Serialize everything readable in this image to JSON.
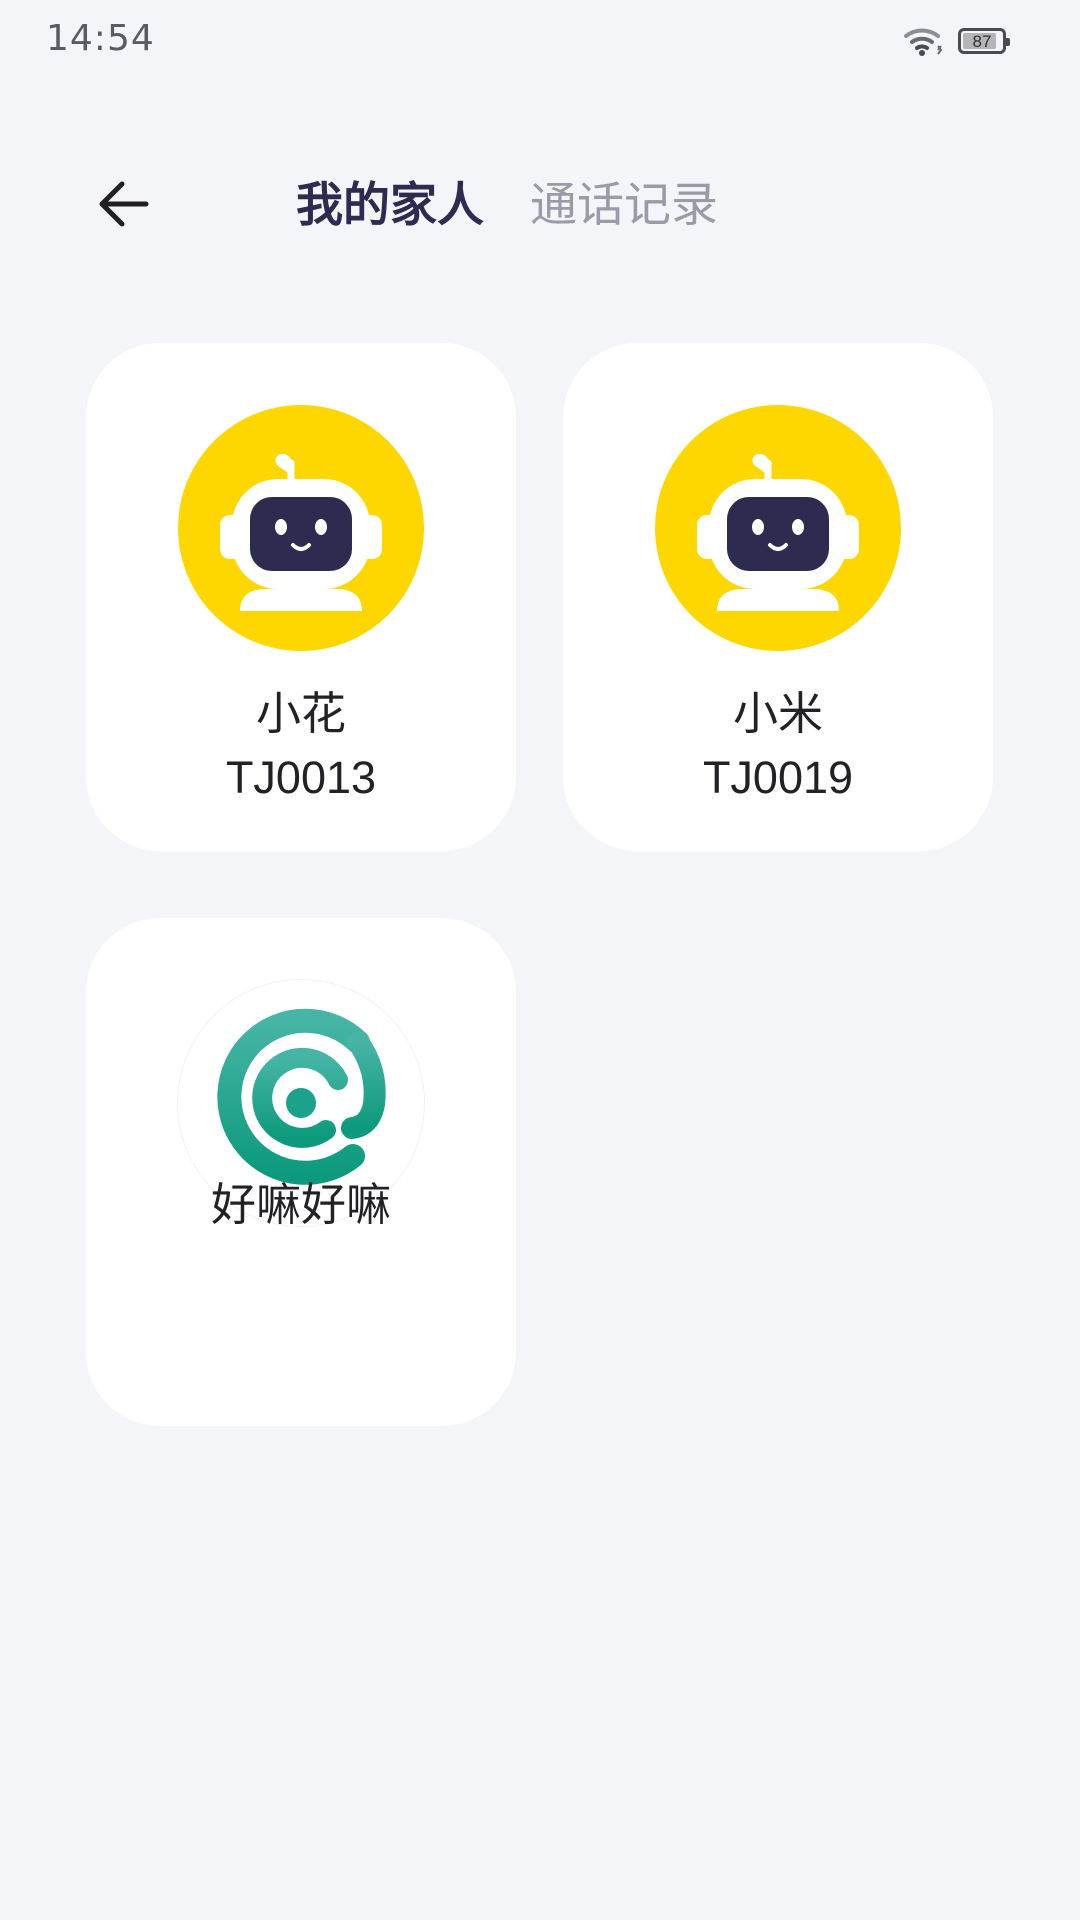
{
  "status_bar": {
    "time": "14:54",
    "battery_level": "87",
    "battery_fraction": 0.87,
    "icons": [
      "wifi-icon",
      "battery-icon"
    ]
  },
  "header": {
    "back_icon": "arrow-left-icon",
    "tabs": [
      {
        "label": "我的家人",
        "active": true
      },
      {
        "label": "通话记录",
        "active": false
      }
    ]
  },
  "contacts": [
    {
      "name": "小花",
      "code": "TJ0013",
      "avatar": "robot-icon"
    },
    {
      "name": "小米",
      "code": "TJ0019",
      "avatar": "robot-icon"
    },
    {
      "name": "好嘛好嘛",
      "code": "",
      "avatar": "teal-at-logo-icon"
    }
  ],
  "colors": {
    "background": "#f4f5f9",
    "card": "#ffffff",
    "active_tab": "#2e2b50",
    "inactive_tab": "#9a9aa8",
    "robot_avatar_bg": "#ffd700",
    "robot_face": "#2e2b50",
    "logo_teal": "#139f87"
  }
}
